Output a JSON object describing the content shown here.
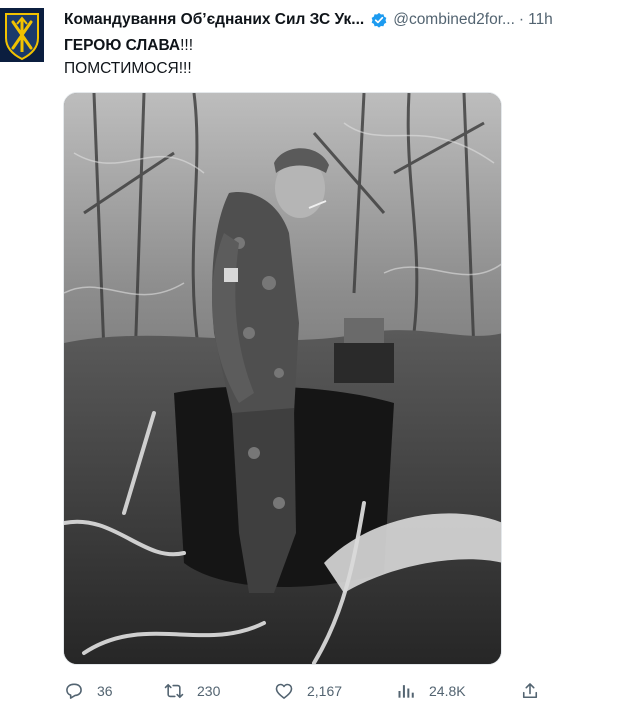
{
  "author": {
    "display_name": "Командування Об’єднаних Сил ЗС Ук...",
    "handle": "@combined2for...",
    "separator": "·",
    "time": "11h",
    "verified": true,
    "avatar_icon": "joint-forces-emblem-icon"
  },
  "tweet": {
    "line1_bold": "ГЕРОЮ СЛАВА",
    "line1_rest": "!!!",
    "line2": "ПОМСТИМОСЯ!!!"
  },
  "media": {
    "type": "photo",
    "style": "black-and-white",
    "subject_icon": "soldier-photo"
  },
  "actions": {
    "replies": "36",
    "retweets": "230",
    "likes": "2,167",
    "views": "24.8K",
    "icons": [
      "reply-icon",
      "retweet-icon",
      "like-icon",
      "views-icon",
      "share-icon"
    ]
  },
  "colors": {
    "text": "#0f1419",
    "secondary": "#536471",
    "verified": "#1d9bf0",
    "avatar_bg": "#0b1e3f",
    "avatar_emblem": "#f2c200"
  }
}
